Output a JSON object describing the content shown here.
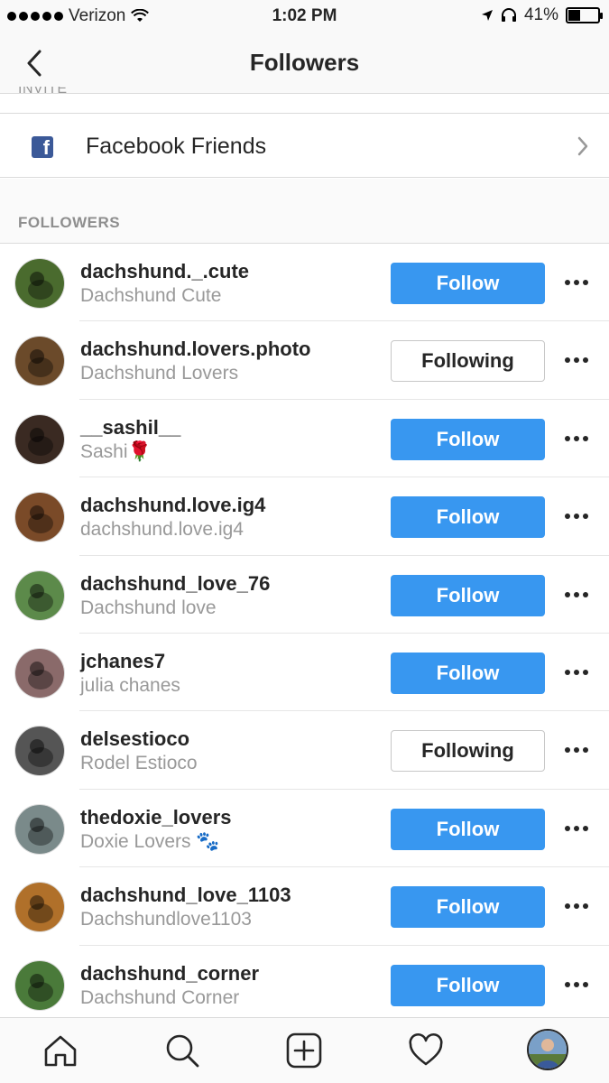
{
  "status_bar": {
    "carrier": "Verizon",
    "time": "1:02 PM",
    "battery_percent": "41%",
    "battery_level": 0.41,
    "icons": [
      "signal-dots-icon",
      "wifi-icon",
      "location-arrow-icon",
      "headphones-icon",
      "battery-icon"
    ]
  },
  "nav": {
    "title": "Followers",
    "back_icon": "chevron-left-icon"
  },
  "invite": {
    "section_label": "INVITE",
    "facebook_label": "Facebook Friends",
    "facebook_icon": "facebook-icon",
    "chevron_icon": "chevron-right-icon"
  },
  "followers": {
    "section_label": "FOLLOWERS",
    "items": [
      {
        "username": "dachshund._.cute",
        "fullname": "Dachshund Cute",
        "button": "Follow",
        "state": "follow",
        "avatar_color": "#4a6b2e"
      },
      {
        "username": "dachshund.lovers.photo",
        "fullname": "Dachshund Lovers",
        "button": "Following",
        "state": "following",
        "avatar_color": "#6b4a2a"
      },
      {
        "username": "__sashil__",
        "fullname": "Sashi🌹",
        "button": "Follow",
        "state": "follow",
        "avatar_color": "#3a2a22"
      },
      {
        "username": "dachshund.love.ig4",
        "fullname": "dachshund.love.ig4",
        "button": "Follow",
        "state": "follow",
        "avatar_color": "#7a4a28"
      },
      {
        "username": "dachshund_love_76",
        "fullname": "Dachshund love",
        "button": "Follow",
        "state": "follow",
        "avatar_color": "#5c8a4a"
      },
      {
        "username": "jchanes7",
        "fullname": "julia chanes",
        "button": "Follow",
        "state": "follow",
        "avatar_color": "#8a6a6a"
      },
      {
        "username": "delsestioco",
        "fullname": "Rodel Estioco",
        "button": "Following",
        "state": "following",
        "avatar_color": "#555555"
      },
      {
        "username": "thedoxie_lovers",
        "fullname": "Doxie Lovers 🐾",
        "button": "Follow",
        "state": "follow",
        "avatar_color": "#7a8a8a"
      },
      {
        "username": "dachshund_love_1103",
        "fullname": "Dachshundlove1103",
        "button": "Follow",
        "state": "follow",
        "avatar_color": "#b0702a"
      },
      {
        "username": "dachshund_corner",
        "fullname": "Dachshund Corner",
        "button": "Follow",
        "state": "follow",
        "avatar_color": "#4a7a3a"
      }
    ]
  },
  "tabbar": {
    "tabs": [
      "home-icon",
      "search-icon",
      "add-post-icon",
      "heart-icon",
      "profile-avatar"
    ]
  },
  "colors": {
    "follow_blue": "#3897f0",
    "facebook_blue": "#3b5998",
    "secondary_text": "#999999"
  }
}
